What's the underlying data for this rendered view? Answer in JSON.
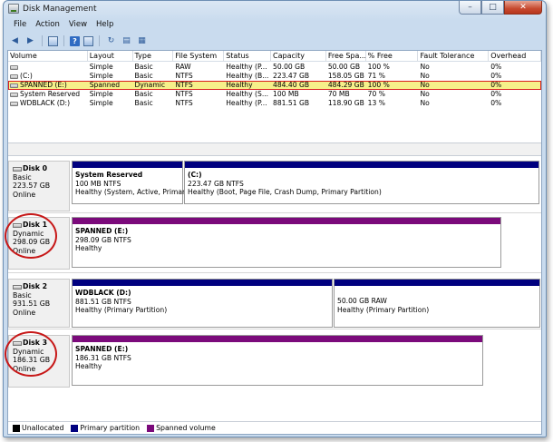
{
  "window": {
    "title": "Disk Management",
    "min": "–",
    "max": "□",
    "close": "✕"
  },
  "menu": [
    "File",
    "Action",
    "View",
    "Help"
  ],
  "table": {
    "columns": [
      "Volume",
      "Layout",
      "Type",
      "File System",
      "Status",
      "Capacity",
      "Free Spa...",
      "% Free",
      "Fault Tolerance",
      "Overhead"
    ],
    "rows": [
      [
        "",
        "Simple",
        "Basic",
        "RAW",
        "Healthy (P...",
        "50.00 GB",
        "50.00 GB",
        "100 %",
        "No",
        "0%"
      ],
      [
        "(C:)",
        "Simple",
        "Basic",
        "NTFS",
        "Healthy (B...",
        "223.47 GB",
        "158.05 GB",
        "71 %",
        "No",
        "0%"
      ],
      [
        "SPANNED (E:)",
        "Spanned",
        "Dynamic",
        "NTFS",
        "Healthy",
        "484.40 GB",
        "484.29 GB",
        "100 %",
        "No",
        "0%"
      ],
      [
        "System Reserved",
        "Simple",
        "Basic",
        "NTFS",
        "Healthy (S...",
        "100 MB",
        "70 MB",
        "70 %",
        "No",
        "0%"
      ],
      [
        "WDBLACK (D:)",
        "Simple",
        "Basic",
        "NTFS",
        "Healthy (P...",
        "881.51 GB",
        "118.90 GB",
        "13 %",
        "No",
        "0%"
      ]
    ]
  },
  "disks": [
    {
      "name": "Disk 0",
      "type": "Basic",
      "size": "223.57 GB",
      "state": "Online",
      "partitions": [
        {
          "name": "System Reserved",
          "detail": "100 MB NTFS",
          "status": "Healthy (System, Active, Primary",
          "kind": "primary"
        },
        {
          "name": "(C:)",
          "detail": "223.47 GB NTFS",
          "status": "Healthy (Boot, Page File, Crash Dump, Primary Partition)",
          "kind": "primary"
        }
      ]
    },
    {
      "name": "Disk 1",
      "type": "Dynamic",
      "size": "298.09 GB",
      "state": "Online",
      "partitions": [
        {
          "name": "SPANNED  (E:)",
          "detail": "298.09 GB NTFS",
          "status": "Healthy",
          "kind": "spanned"
        }
      ]
    },
    {
      "name": "Disk 2",
      "type": "Basic",
      "size": "931.51 GB",
      "state": "Online",
      "partitions": [
        {
          "name": "WDBLACK  (D:)",
          "detail": "881.51 GB NTFS",
          "status": "Healthy (Primary Partition)",
          "kind": "primary"
        },
        {
          "name": "",
          "detail": "50.00 GB RAW",
          "status": "Healthy (Primary Partition)",
          "kind": "primary"
        }
      ]
    },
    {
      "name": "Disk 3",
      "type": "Dynamic",
      "size": "186.31 GB",
      "state": "Online",
      "partitions": [
        {
          "name": "SPANNED  (E:)",
          "detail": "186.31 GB NTFS",
          "status": "Healthy",
          "kind": "spanned"
        }
      ]
    }
  ],
  "legend": [
    {
      "label": "Unallocated",
      "color": "#000000"
    },
    {
      "label": "Primary partition",
      "color": "#00007f"
    },
    {
      "label": "Spanned volume",
      "color": "#7b0a7b"
    }
  ]
}
